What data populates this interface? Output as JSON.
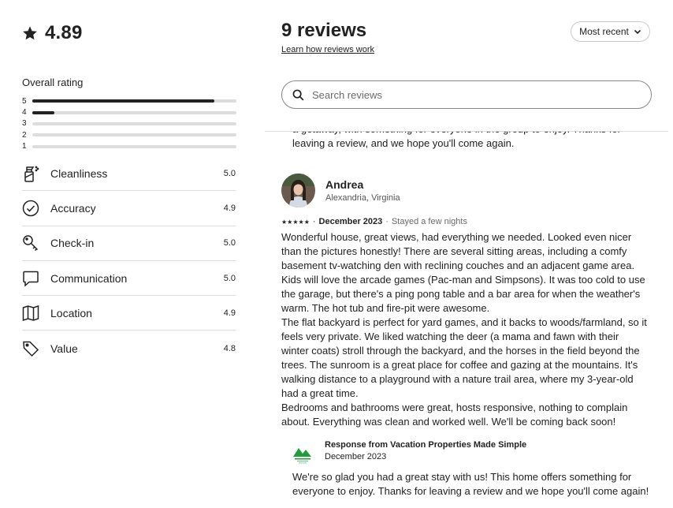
{
  "summary": {
    "score": "4.89",
    "overall_label": "Overall rating",
    "distribution": [
      {
        "stars": "5",
        "fraction": 0.89
      },
      {
        "stars": "4",
        "fraction": 0.11
      },
      {
        "stars": "3",
        "fraction": 0
      },
      {
        "stars": "2",
        "fraction": 0
      },
      {
        "stars": "1",
        "fraction": 0
      }
    ],
    "categories": [
      {
        "label": "Cleanliness",
        "value": "5.0",
        "icon": "spray-bottle-icon"
      },
      {
        "label": "Accuracy",
        "value": "4.9",
        "icon": "check-circle-icon"
      },
      {
        "label": "Check-in",
        "value": "5.0",
        "icon": "key-icon"
      },
      {
        "label": "Communication",
        "value": "5.0",
        "icon": "chat-bubble-icon"
      },
      {
        "label": "Location",
        "value": "4.9",
        "icon": "map-icon"
      },
      {
        "label": "Value",
        "value": "4.8",
        "icon": "tag-icon"
      }
    ]
  },
  "header": {
    "title": "9 reviews",
    "learn_link": "Learn how reviews work",
    "sort_label": "Most recent"
  },
  "search": {
    "placeholder": "Search reviews"
  },
  "previous_response": {
    "text": "a getaway, with something for everyone in the group to enjoy. Thanks for leaving a review, and we hope you'll come again."
  },
  "review": {
    "name": "Andrea",
    "location": "Alexandria, Virginia",
    "stars": "★★★★★",
    "date": "December 2023",
    "stay": "Stayed a few nights",
    "paragraphs": [
      "Wonderful house, great views, had everything we needed. Looked even nicer than the pictures honestly! There are several sitting areas, including a comfy basement tv-watching den with reclining couches and an adjacent game area. Kids will love the arcade games (Pac-man and Simpsons). It was too cold to use the garage, but there's a ping pong table and a bar area for when the weather's warm. The hot tub and fire-pit were awesome.",
      "The flat backyard is perfect for yard games, and it backs to woods/farmland, so it feels very private. We liked watching the deer (a mama and fawn with their winter coats) stroll through the backyard, and the horses in the field beyond the trees. The sunroom is a great place for coffee and gazing at the mountains. It's walking distance to a playground with a nature trail area, where my 3-year-old had a great time.",
      "Bedrooms and bathrooms were great, hosts responsive, nothing to complain about. Everything was clean and worked well. We'll be coming back soon!"
    ],
    "response": {
      "title": "Response from Vacation Properties Made Simple",
      "date": "December 2023",
      "text": "We're so glad you had a great stay with us! This home offers something for everyone to enjoy. Thanks for leaving a review and we hope you'll come again!"
    }
  },
  "colors": {
    "text": "#222222",
    "muted": "#6a6a6a",
    "divider": "#dddddd",
    "logo_green": "#1e9e3a"
  }
}
